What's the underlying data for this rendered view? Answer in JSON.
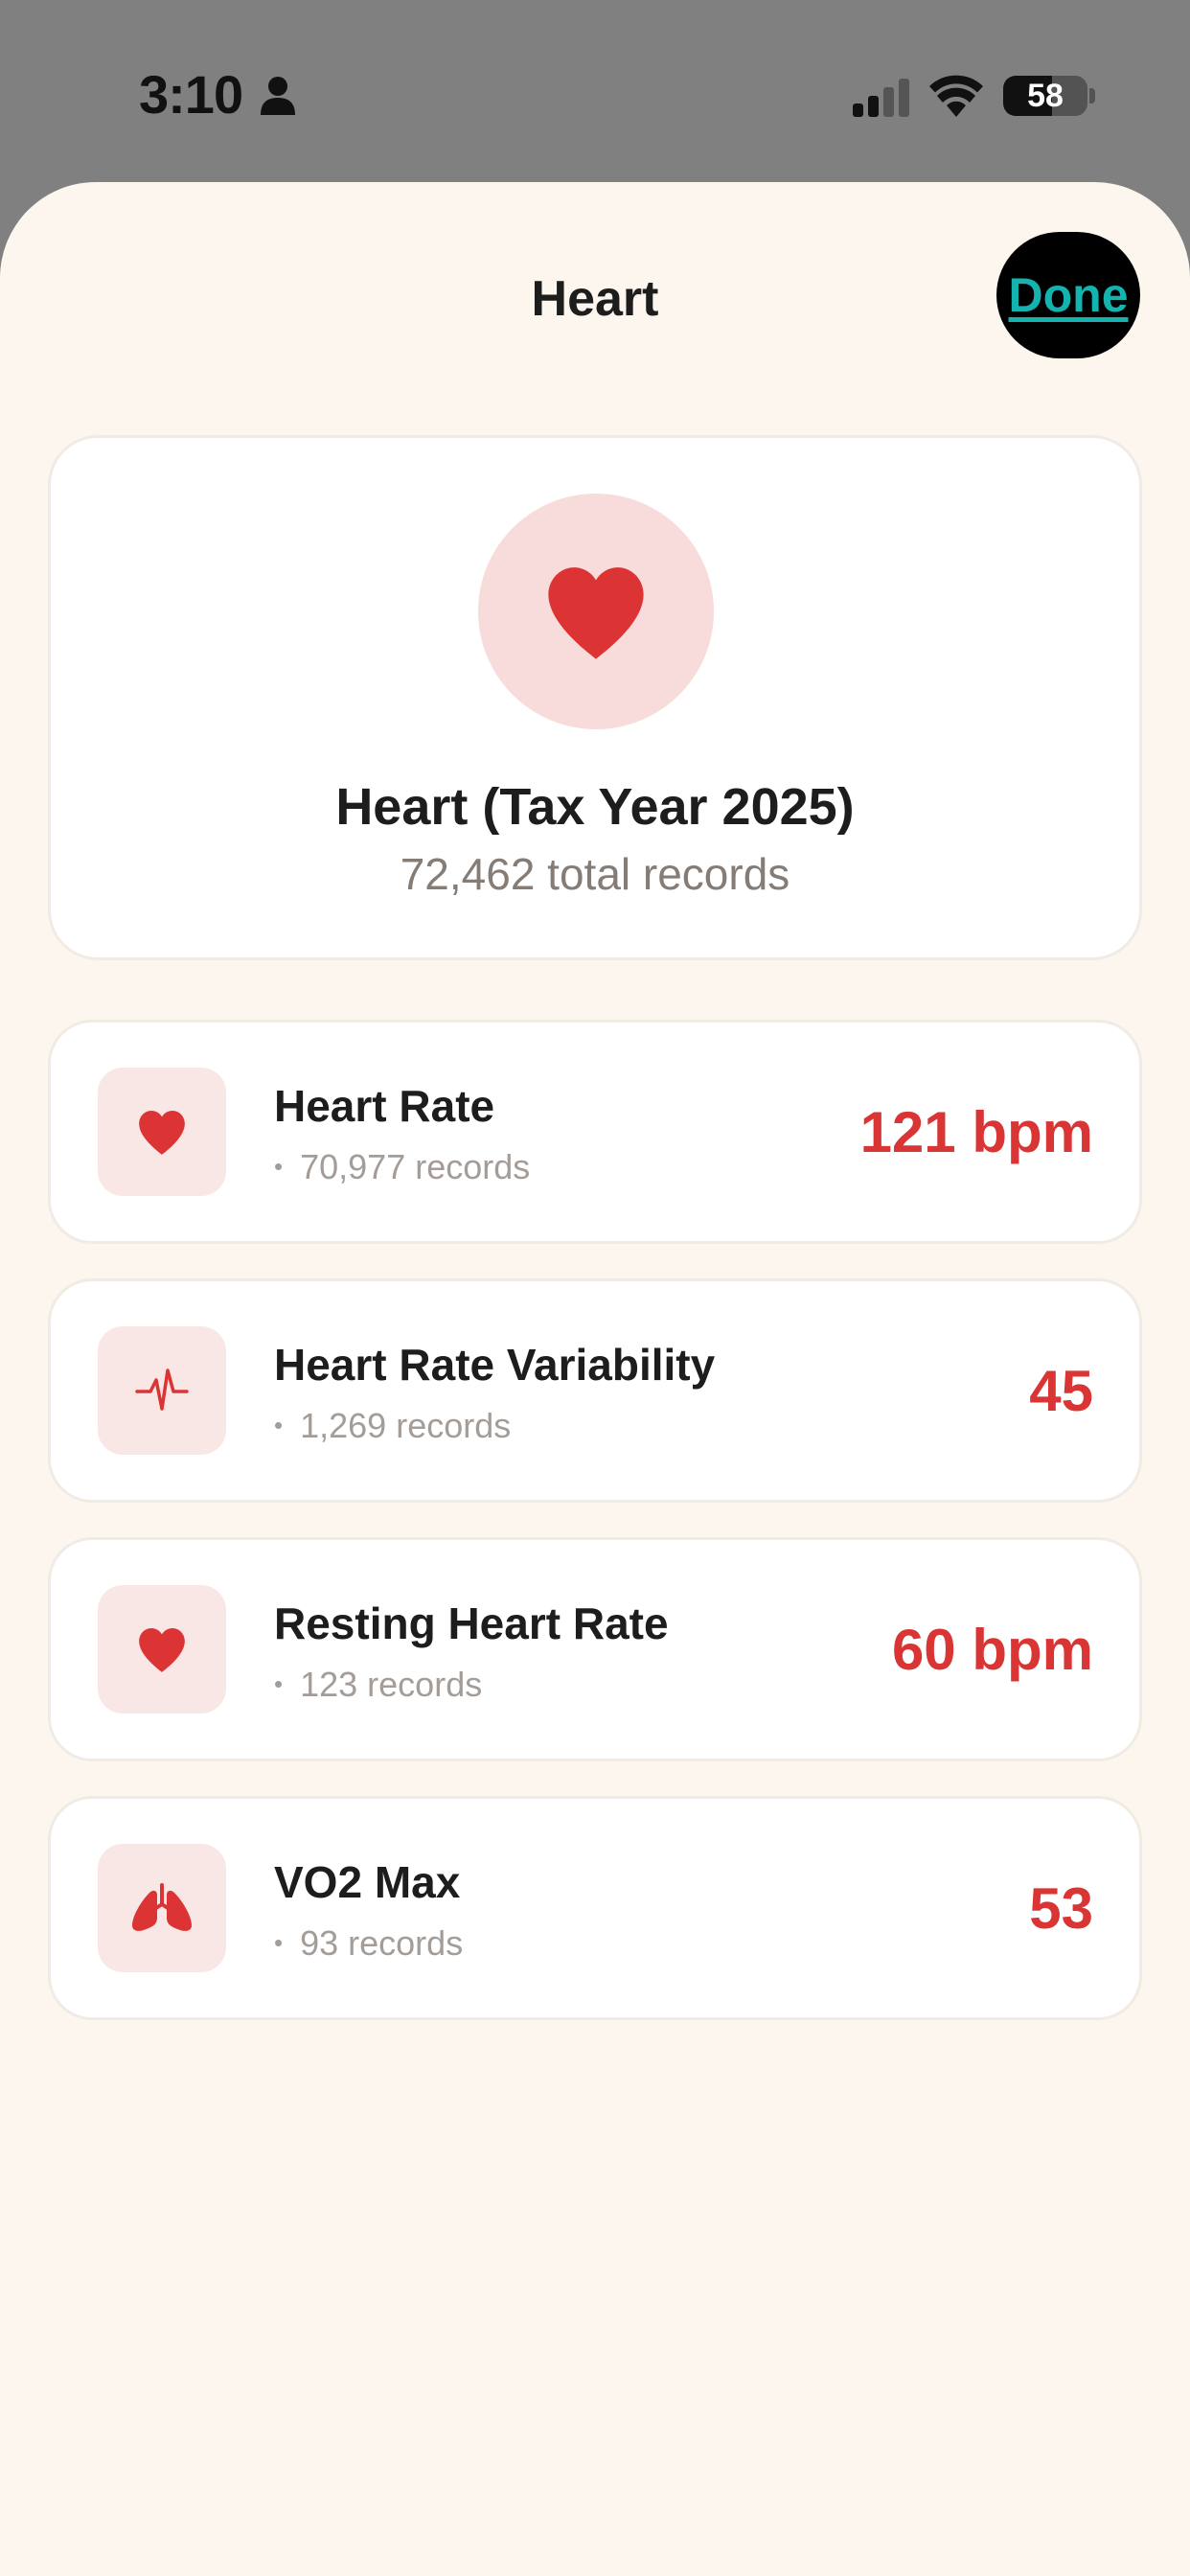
{
  "status_bar": {
    "time": "3:10",
    "battery": "58",
    "battery_level": 0.58,
    "person_icon": "person-icon",
    "signal_icon": "cellular-signal-icon",
    "wifi_icon": "wifi-icon"
  },
  "sheet": {
    "title": "Heart",
    "done_label": "Done"
  },
  "hero": {
    "icon": "heart-icon",
    "title": "Heart (Tax Year 2025)",
    "subtitle": "72,462 total records"
  },
  "metrics": [
    {
      "name": "Heart Rate",
      "records": "70,977 records",
      "value": "121 bpm",
      "icon": "heart-icon"
    },
    {
      "name": "Heart Rate Variability",
      "records": "1,269 records",
      "value": "45",
      "icon": "waveform-icon"
    },
    {
      "name": "Resting Heart Rate",
      "records": "123 records",
      "value": "60 bpm",
      "icon": "heart-icon"
    },
    {
      "name": "VO2 Max",
      "records": "93 records",
      "value": "53",
      "icon": "lungs-icon"
    }
  ],
  "colors": {
    "accent_red": "#d93535",
    "done_text": "#14b3b0",
    "sheet_background": "#fcf6ef",
    "icon_tint_background": "#f9e7e6"
  }
}
